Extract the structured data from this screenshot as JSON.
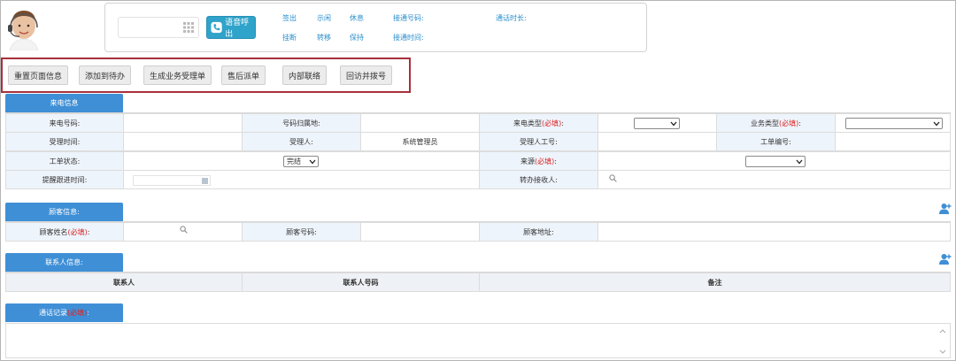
{
  "header": {
    "call_button_label": "语音呼出",
    "dial_placeholder": "",
    "controls_row1": [
      "签出",
      "示闲",
      "休息"
    ],
    "controls_row2": [
      "挂断",
      "转移",
      "保持"
    ],
    "meta": {
      "incoming_number": "接通号码:",
      "call_duration": "通话时长:",
      "connect_time": "接通时间:"
    }
  },
  "toolbar": {
    "buttons": [
      "重置页面信息",
      "添加到待办",
      "生成业务受理单",
      "售后派单",
      "内部联络",
      "回访并拨号"
    ]
  },
  "call_info": {
    "section_title": "来电信息",
    "row1": {
      "caller_number_label": "来电号码:",
      "number_location_label": "号码归属地:",
      "call_type_label": "来电类型",
      "business_type_label": "业务类型",
      "required_mark": "(必填)",
      "colon": ":"
    },
    "row2": {
      "accept_time_label": "受理时间:",
      "acceptor_label": "受理人:",
      "acceptor_value": "系统管理员",
      "acceptor_id_label": "受理人工号:",
      "ticket_no_label": "工单编号:"
    },
    "row3": {
      "ticket_status_label": "工单状态:",
      "ticket_status_value": "完结",
      "source_label": "来源",
      "source_required": "(必填)",
      "colon": ":"
    },
    "row4": {
      "reminder_time_label": "提醒跟进时间:",
      "transfer_receiver_label": "转办接收人:"
    }
  },
  "customer_info": {
    "section_title": "顾客信息:",
    "name_label": "顾客姓名",
    "name_required": "(必填)",
    "colon": ":",
    "number_label": "顾客号码:",
    "address_label": "顾客地址:"
  },
  "contact_info": {
    "section_title": "联系人信息:",
    "columns": [
      "联系人",
      "联系人号码",
      "备注"
    ]
  },
  "call_record": {
    "section_title": "通话记录",
    "required_mark": "(必填)",
    "colon": ":"
  },
  "colors": {
    "accent": "#3f8fd6",
    "call_button": "#2fa3c9",
    "link": "#2a8ecc",
    "label_bg": "#eef4fb",
    "required": "#dd2222",
    "toolbar_highlight": "#a8303c"
  },
  "icons": [
    "avatar",
    "keypad-icon",
    "phone-icon",
    "search-icon",
    "calendar-icon",
    "add-user-icon",
    "chevron-down-icon"
  ]
}
